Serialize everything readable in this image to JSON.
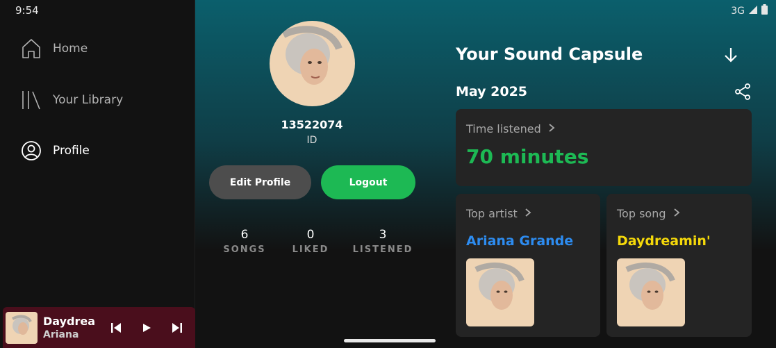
{
  "status": {
    "time": "9:54",
    "network": "3G"
  },
  "sidebar": {
    "items": [
      {
        "label": "Home",
        "icon": "home-icon",
        "active": false
      },
      {
        "label": "Your Library",
        "icon": "library-icon",
        "active": false
      },
      {
        "label": "Profile",
        "icon": "profile-icon",
        "active": true
      }
    ]
  },
  "profile": {
    "id_value": "13522074",
    "id_label": "ID",
    "edit_button": "Edit Profile",
    "logout_button": "Logout",
    "stats": [
      {
        "value": "6",
        "label": "SONGS"
      },
      {
        "value": "0",
        "label": "LIKED"
      },
      {
        "value": "3",
        "label": "LISTENED"
      }
    ]
  },
  "capsule": {
    "title": "Your Sound Capsule",
    "month": "May 2025",
    "time_listened": {
      "label": "Time listened",
      "value": "70 minutes"
    },
    "top_artist": {
      "label": "Top artist",
      "value": "Ariana Grande"
    },
    "top_song": {
      "label": "Top song",
      "value": "Daydreamin'"
    }
  },
  "player": {
    "title": "Daydrea",
    "artist": "Ariana"
  },
  "colors": {
    "accent": "#1db954",
    "artist": "#2d8cf0",
    "song": "#f5d90a",
    "player_bg": "#4a0e1c"
  }
}
